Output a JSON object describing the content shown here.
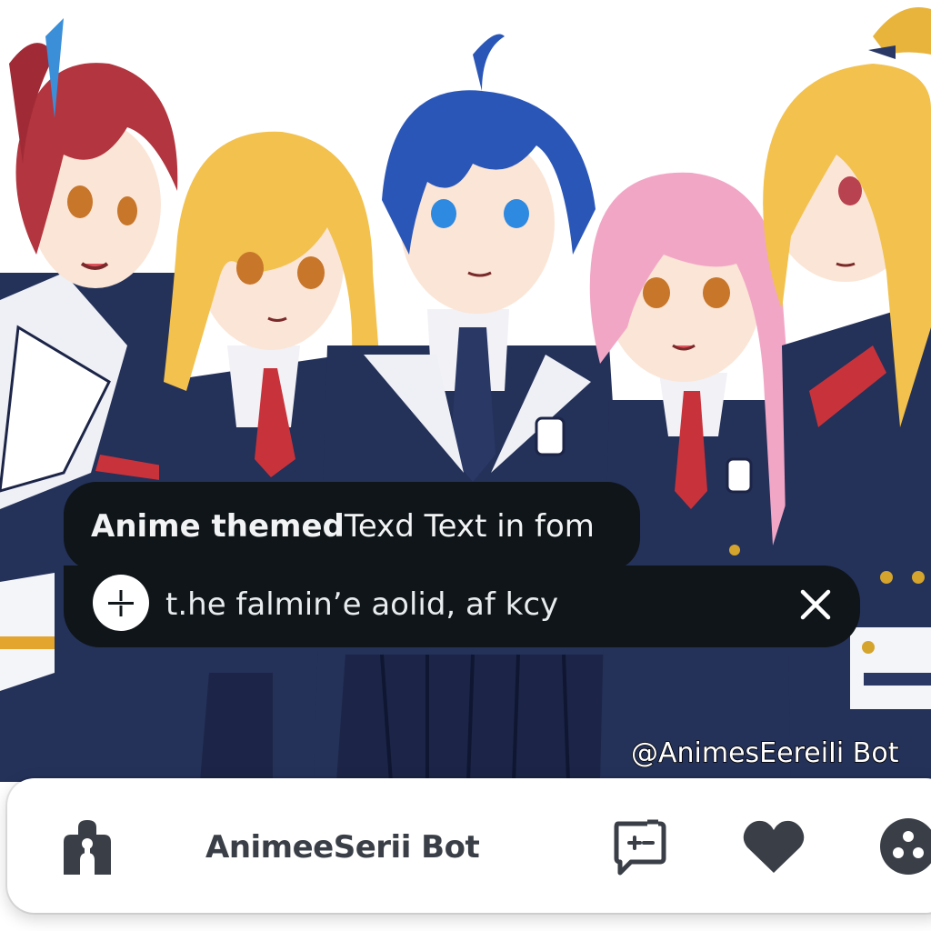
{
  "caption": {
    "bold_part": "Anime themed",
    "regular_part": "Texd  Text in fom"
  },
  "message": {
    "text": "t.he falmin’e aolid, af kcy",
    "add_icon": "add-circle-icon",
    "close_icon": "close-icon"
  },
  "watermark": "@AnimesEereiIi Bot",
  "bottom_bar": {
    "bot_name": "AnimeeSerii Bot",
    "profile_icon": "profile-icon",
    "new_chat_icon": "new-chat-icon",
    "like_icon": "heart-icon",
    "menu_icon": "more-options-icon"
  },
  "colors": {
    "bubble_bg": "#0f1518",
    "bubble_text": "#f1f3f4",
    "bar_icons": "#3a3f47",
    "uniform_navy": "#243159",
    "tie_red": "#c8333b"
  }
}
